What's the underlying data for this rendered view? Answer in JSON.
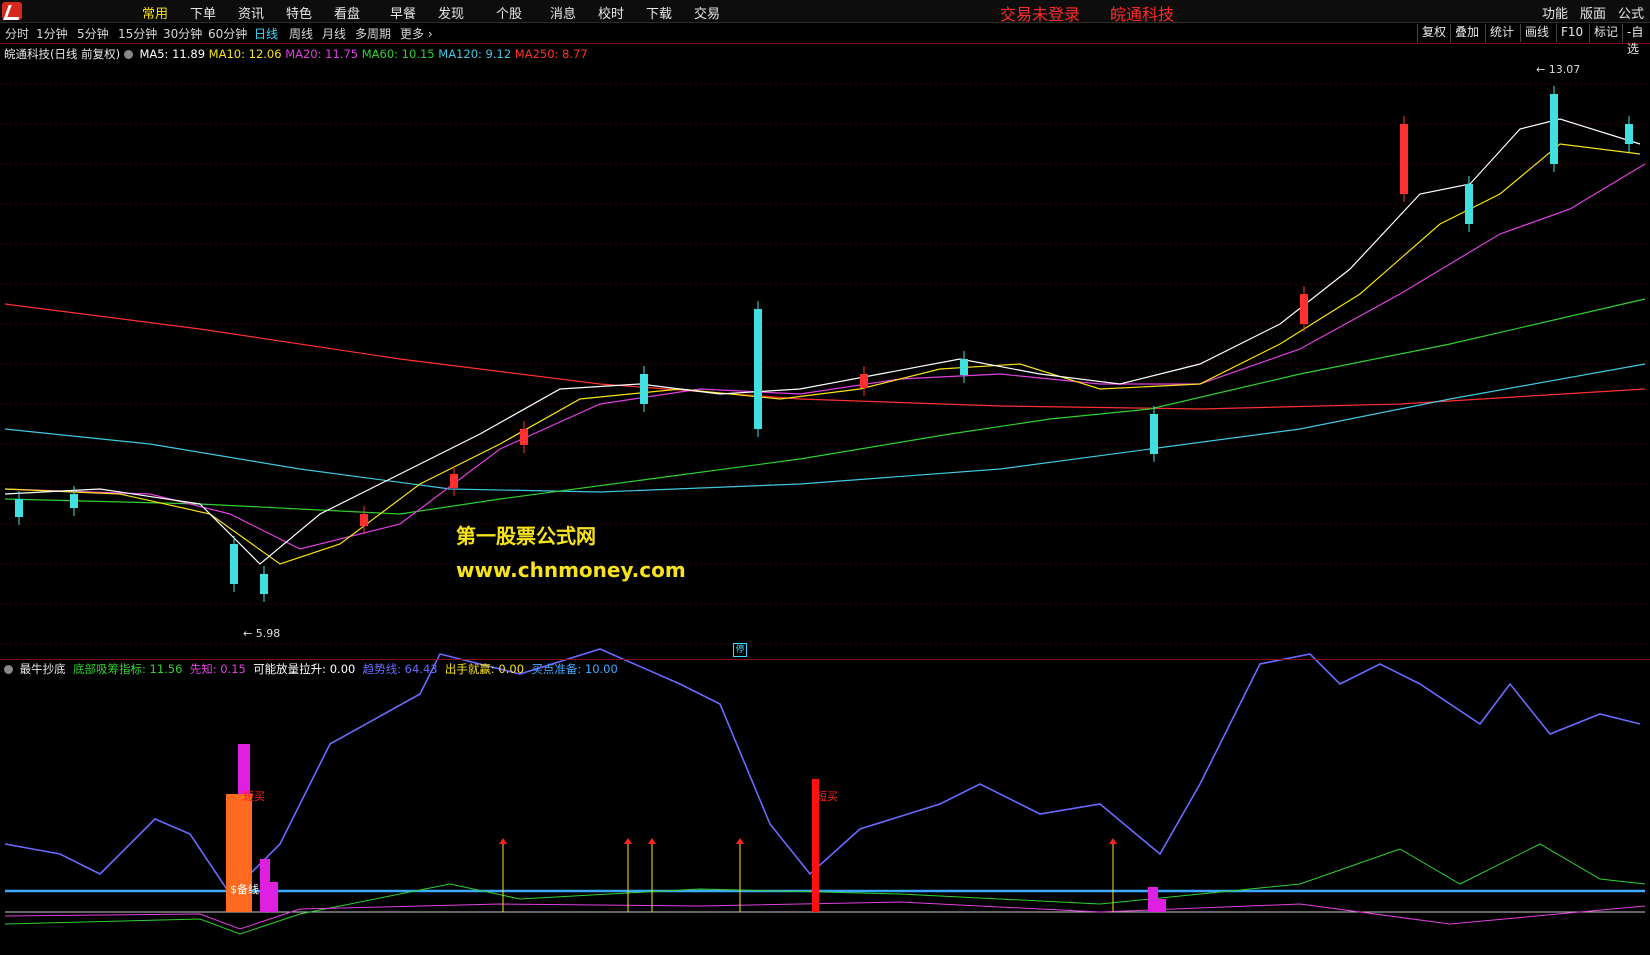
{
  "menubar": {
    "items": [
      "常用",
      "下单",
      "资讯",
      "特色",
      "看盘",
      "早餐",
      "发现",
      "个股",
      "消息",
      "校时",
      "下载",
      "交易"
    ],
    "active_index": 0,
    "status_login": "交易未登录",
    "stock_name_header": "皖通科技",
    "right_items": [
      "功能",
      "版面",
      "公式"
    ]
  },
  "periodbar": {
    "periods": [
      "分时",
      "1分钟",
      "5分钟",
      "15分钟",
      "30分钟",
      "60分钟",
      "日线",
      "周线",
      "月线",
      "多周期",
      "更多"
    ],
    "active_index": 6,
    "tools": [
      "复权",
      "叠加",
      "统计",
      "画线",
      "F10",
      "标记",
      "-自选"
    ]
  },
  "main_chart": {
    "title": "皖通科技(日线 前复权)",
    "ma": [
      {
        "label": "MA5: 11.89",
        "color": "#ffffff"
      },
      {
        "label": "MA10: 12.06",
        "color": "#f7e21b"
      },
      {
        "label": "MA20: 11.75",
        "color": "#e040e0"
      },
      {
        "label": "MA60: 10.15",
        "color": "#30d030"
      },
      {
        "label": "MA120: 9.12",
        "color": "#40c8e0"
      },
      {
        "label": "MA250: 8.77",
        "color": "#ff3030"
      }
    ],
    "high_label": "13.07",
    "low_label": "5.98",
    "watermark_cn": "第一股票公式网",
    "watermark_url": "www.chnmoney.com",
    "stop_marker": "停"
  },
  "indicator": {
    "name": "最牛抄底",
    "values": [
      {
        "label": "底部吸筹指标: 11.56",
        "color": "#30d030"
      },
      {
        "label": "先知: 0.15",
        "color": "#e040e0"
      },
      {
        "label": "可能放量拉升: 0.00",
        "color": "#ffffff"
      },
      {
        "label": "趋势线: 64.43",
        "color": "#6a6aff"
      },
      {
        "label": "出手就赢: 0.00",
        "color": "#f7e21b"
      },
      {
        "label": "买点准备: 10.00",
        "color": "#3fa8ff"
      }
    ],
    "signal_short_buy": "短买",
    "signal_short_buy2": "短买",
    "ready_line_label": "$备线"
  }
}
